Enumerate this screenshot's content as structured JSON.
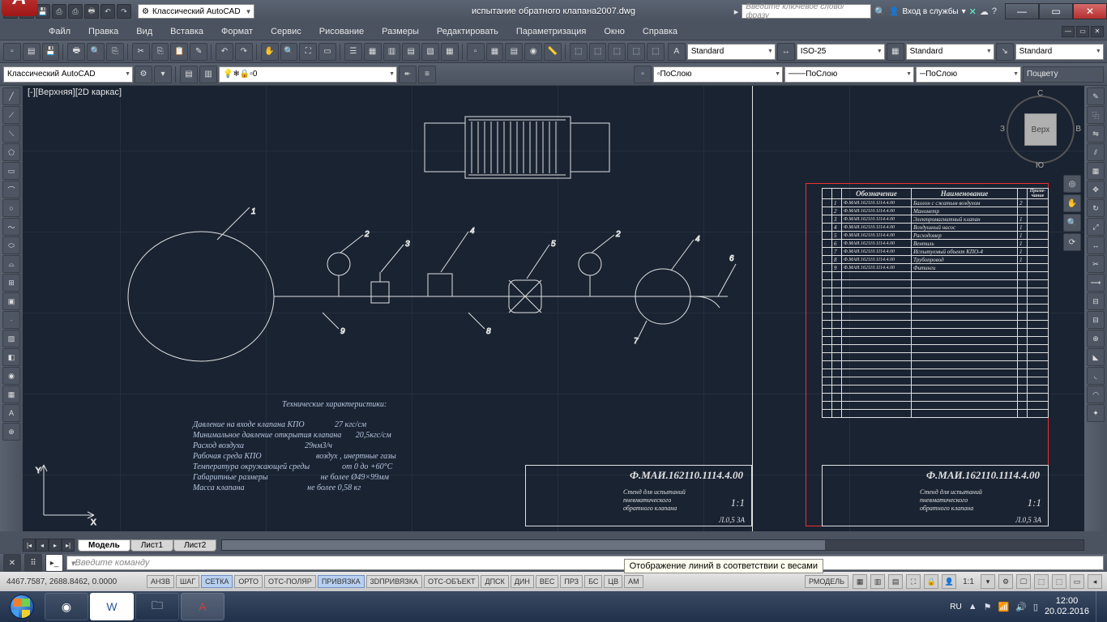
{
  "titlebar": {
    "workspace": "Классический AutoCAD",
    "document": "испытание обратного клапана2007.dwg",
    "search_placeholder": "Введите ключевое слово/фразу",
    "login": "Вход в службы"
  },
  "menus": [
    "Файл",
    "Правка",
    "Вид",
    "Вставка",
    "Формат",
    "Сервис",
    "Рисование",
    "Размеры",
    "Редактировать",
    "Параметризация",
    "Окно",
    "Справка"
  ],
  "styles": {
    "text_style": "Standard",
    "dim_style": "ISO-25",
    "table_style": "Standard",
    "mleader_style": "Standard"
  },
  "layers": {
    "workspace_dd": "Классический AutoCAD",
    "current_layer": "0",
    "bylayer1": "ПоСлою",
    "bylayer2": "ПоСлою",
    "bylayer3": "ПоСлою",
    "bycolor": "Поцвету"
  },
  "viewport": {
    "label": "[-][Верхняя][2D каркас]"
  },
  "viewcube": {
    "face": "Верх",
    "n": "С",
    "s": "Ю",
    "e": "В",
    "w": "З"
  },
  "bom": {
    "h1": "Обозначение",
    "h2": "Наименование",
    "rows": [
      {
        "n": "1",
        "des": "Ф.МАИ.162110.1114.4.00",
        "name": "Баллон с сжатым воздухом",
        "q": "2"
      },
      {
        "n": "2",
        "des": "Ф.МАИ.162110.1114.4.00",
        "name": "Манометр",
        "q": ""
      },
      {
        "n": "3",
        "des": "Ф.МАИ.162110.1114.4.00",
        "name": "Электромагнитный клапан",
        "q": "1"
      },
      {
        "n": "4",
        "des": "Ф.МАИ.162110.1114.4.00",
        "name": "Воздушный насос",
        "q": "1"
      },
      {
        "n": "5",
        "des": "Ф.МАИ.162110.1114.4.00",
        "name": "Расходомер",
        "q": "1"
      },
      {
        "n": "6",
        "des": "Ф.МАИ.162110.1114.4.00",
        "name": "Вентиль",
        "q": "1"
      },
      {
        "n": "7",
        "des": "Ф.МАИ.162110.1114.4.00",
        "name": "Испытуемый объект КПО-4",
        "q": "1"
      },
      {
        "n": "8",
        "des": "Ф.МАИ.162110.1114.4.00",
        "name": "Трубопровод",
        "q": "1"
      },
      {
        "n": "9",
        "des": "Ф.МАИ.162110.1114.4.00",
        "name": "Фитинги",
        "q": ""
      }
    ]
  },
  "tech": {
    "header": "Технические характеристики:",
    "rows": [
      [
        "Давление на входе клапана КПО",
        "27 кгс/см"
      ],
      [
        "Минимальное давление открытия клапана",
        "20,5кгс/см"
      ],
      [
        "Расход воздуха",
        "29нм3/ч"
      ],
      [
        "Рабочая среда КПО",
        "воздух , инертные газы"
      ],
      [
        "Температура окружающей среды",
        "от 0 до +60°C"
      ],
      [
        "Габаритные размеры",
        "не более Ø49×99мм"
      ],
      [
        "Масса клапана",
        "не более 0,58 кг"
      ]
    ]
  },
  "titleblock": {
    "code": "Ф.МАИ.162110.1114.4.00",
    "name1": "Стенд для испытаний",
    "name2": "пневматического",
    "name3": "обратного клапана",
    "scale": "1:1",
    "sheet": "Л.0,5  3А"
  },
  "tabs": {
    "model": "Модель",
    "l1": "Лист1",
    "l2": "Лист2"
  },
  "cmd": {
    "placeholder": "Введите команду"
  },
  "tooltip": "Отображение линий в соответствии с весами",
  "status": {
    "coords": "4467.7587, 2688.8462, 0.0000",
    "buttons": [
      "АНЗВ",
      "ШАГ",
      "СЕТКА",
      "ОРТО",
      "ОТС-ПОЛЯР",
      "ПРИВЯЗКА",
      "3DПРИВЯЗКА",
      "ОТС-ОБЪЕКТ",
      "ДПСК",
      "ДИН",
      "ВЕС",
      "ПРЗ",
      "БС",
      "ЦВ",
      "АМ"
    ],
    "on": {
      "СЕТКА": true,
      "ПРИВЯЗКА": true
    },
    "rmodel": "РМОДЕЛЬ",
    "scale": "1:1"
  },
  "tray": {
    "lang": "RU",
    "time": "12:00",
    "date": "20.02.2016"
  }
}
